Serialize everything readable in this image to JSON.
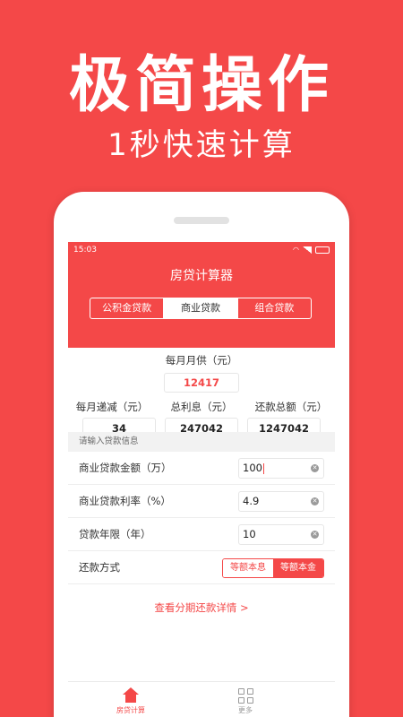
{
  "promo": {
    "title": "极简操作",
    "subtitle": "1秒快速计算"
  },
  "status_bar": {
    "time": "15:03"
  },
  "app": {
    "title": "房贷计算器",
    "tabs": [
      {
        "label": "公积金贷款",
        "active": false
      },
      {
        "label": "商业贷款",
        "active": true
      },
      {
        "label": "组合贷款",
        "active": false
      }
    ]
  },
  "results": {
    "monthly_label": "每月月供（元）",
    "monthly_value": "12417",
    "decrease_label": "每月递减（元）",
    "decrease_value": "34",
    "interest_label": "总利息（元）",
    "interest_value": "247042",
    "total_label": "还款总额（元）",
    "total_value": "1247042"
  },
  "form": {
    "section_title": "请输入贷款信息",
    "amount_label": "商业贷款金额（万）",
    "amount_value": "100",
    "rate_label": "商业贷款利率（%）",
    "rate_value": "4.9",
    "years_label": "贷款年限（年）",
    "years_value": "10",
    "method_label": "还款方式",
    "method_options": [
      {
        "label": "等额本息",
        "active": false
      },
      {
        "label": "等额本金",
        "active": true
      }
    ]
  },
  "detail_link": "查看分期还款详情 >",
  "bottom_nav": {
    "items": [
      {
        "label": "房贷计算",
        "active": true
      },
      {
        "label": "更多",
        "active": false
      }
    ]
  },
  "colors": {
    "accent": "#f44848",
    "background": "#ffffff"
  }
}
